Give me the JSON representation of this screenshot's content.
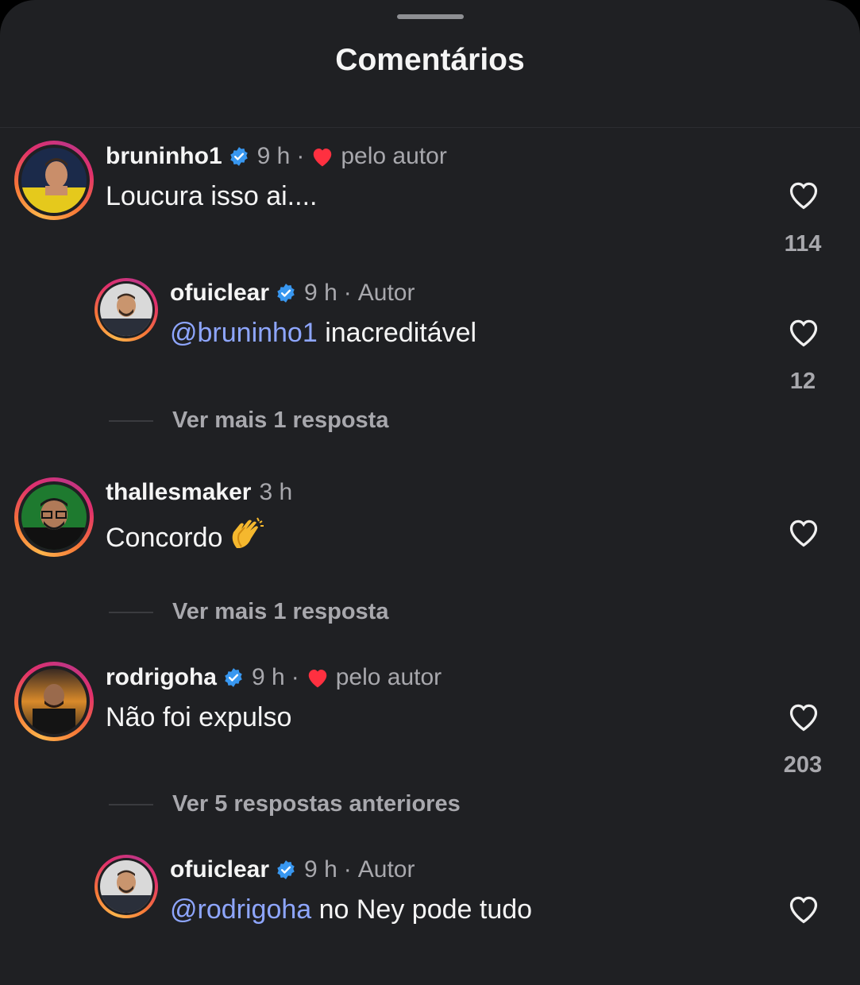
{
  "header": {
    "title": "Comentários"
  },
  "comments": [
    {
      "user": "bruninho1",
      "verified": true,
      "time": "9 h",
      "liked_by_author": "pelo autor",
      "text": "Loucura isso ai....",
      "likes": "114"
    },
    {
      "user": "ofuiclear",
      "verified": true,
      "time": "9 h",
      "tag": "Autor",
      "mention": "@bruninho1",
      "text": " inacreditável",
      "likes": "12"
    },
    {
      "more_replies": "Ver mais 1 resposta"
    },
    {
      "user": "thallesmaker",
      "time": "3 h",
      "text": "Concordo",
      "emoji": "clapping-hands"
    },
    {
      "more_replies": "Ver mais 1 resposta"
    },
    {
      "user": "rodrigoha",
      "verified": true,
      "time": "9 h",
      "liked_by_author": "pelo autor",
      "text": "Não foi expulso",
      "likes": "203"
    },
    {
      "more_replies": "Ver 5 respostas anteriores"
    },
    {
      "user": "ofuiclear",
      "verified": true,
      "time": "9 h",
      "tag": "Autor",
      "mention": "@rodrigoha",
      "text": " no Ney pode tudo"
    }
  ],
  "colors": {
    "background": "#1f2023",
    "mention": "#8ea6ff",
    "verified": "#3897f0",
    "heart": "#ff3040"
  }
}
